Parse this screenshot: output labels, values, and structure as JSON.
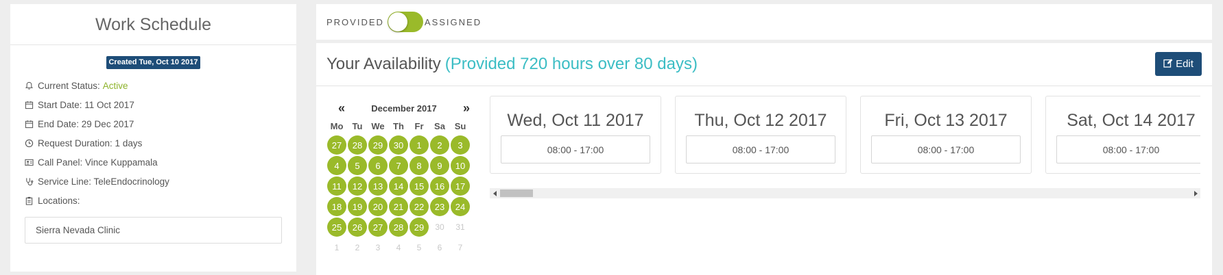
{
  "left_panel": {
    "title": "Work Schedule",
    "created_badge": "Created Tue, Oct 10 2017",
    "status_label": "Current Status:",
    "status_value": "Active",
    "start_date": "Start Date: 11 Oct 2017",
    "end_date": "End Date: 29 Dec 2017",
    "request_duration": "Request Duration: 1 days",
    "call_panel": "Call Panel: Vince Kuppamala",
    "service_line": "Service Line: TeleEndocrinology",
    "locations_label": "Locations:",
    "location": "Sierra Nevada Clinic"
  },
  "toggle": {
    "left_label": "PROVIDED",
    "right_label": "ASSIGNED"
  },
  "availability": {
    "title": "Your Availability",
    "subtitle": "(Provided 720 hours over 80 days)",
    "edit_label": "Edit"
  },
  "calendar": {
    "prev": "«",
    "next": "»",
    "month": "December 2017",
    "weekdays": [
      "Mo",
      "Tu",
      "We",
      "Th",
      "Fr",
      "Sa",
      "Su"
    ],
    "weeks": [
      [
        {
          "d": "27",
          "s": "avail"
        },
        {
          "d": "28",
          "s": "avail"
        },
        {
          "d": "29",
          "s": "avail"
        },
        {
          "d": "30",
          "s": "avail"
        },
        {
          "d": "1",
          "s": "avail"
        },
        {
          "d": "2",
          "s": "avail"
        },
        {
          "d": "3",
          "s": "avail"
        }
      ],
      [
        {
          "d": "4",
          "s": "avail"
        },
        {
          "d": "5",
          "s": "avail"
        },
        {
          "d": "6",
          "s": "avail"
        },
        {
          "d": "7",
          "s": "avail"
        },
        {
          "d": "8",
          "s": "avail"
        },
        {
          "d": "9",
          "s": "avail"
        },
        {
          "d": "10",
          "s": "avail"
        }
      ],
      [
        {
          "d": "11",
          "s": "avail"
        },
        {
          "d": "12",
          "s": "avail"
        },
        {
          "d": "13",
          "s": "avail"
        },
        {
          "d": "14",
          "s": "avail"
        },
        {
          "d": "15",
          "s": "avail"
        },
        {
          "d": "16",
          "s": "avail"
        },
        {
          "d": "17",
          "s": "avail"
        }
      ],
      [
        {
          "d": "18",
          "s": "avail"
        },
        {
          "d": "19",
          "s": "avail"
        },
        {
          "d": "20",
          "s": "avail"
        },
        {
          "d": "21",
          "s": "avail"
        },
        {
          "d": "22",
          "s": "avail"
        },
        {
          "d": "23",
          "s": "avail"
        },
        {
          "d": "24",
          "s": "avail"
        }
      ],
      [
        {
          "d": "25",
          "s": "avail"
        },
        {
          "d": "26",
          "s": "avail"
        },
        {
          "d": "27",
          "s": "avail"
        },
        {
          "d": "28",
          "s": "avail"
        },
        {
          "d": "29",
          "s": "avail"
        },
        {
          "d": "30",
          "s": "muted"
        },
        {
          "d": "31",
          "s": "muted"
        }
      ],
      [
        {
          "d": "1",
          "s": "muted"
        },
        {
          "d": "2",
          "s": "muted"
        },
        {
          "d": "3",
          "s": "muted"
        },
        {
          "d": "4",
          "s": "muted"
        },
        {
          "d": "5",
          "s": "muted"
        },
        {
          "d": "6",
          "s": "muted"
        },
        {
          "d": "7",
          "s": "muted"
        }
      ]
    ]
  },
  "day_cards": [
    {
      "date": "Wed, Oct 11 2017",
      "slot": "08:00 - 17:00"
    },
    {
      "date": "Thu, Oct 12 2017",
      "slot": "08:00 - 17:00"
    },
    {
      "date": "Fri, Oct 13 2017",
      "slot": "08:00 - 17:00"
    },
    {
      "date": "Sat, Oct 14 2017",
      "slot": "08:00 - 17:00"
    }
  ],
  "colors": {
    "accent_green": "#9aba2a",
    "brand_navy": "#1e4d78",
    "teal": "#3bbdc4"
  }
}
